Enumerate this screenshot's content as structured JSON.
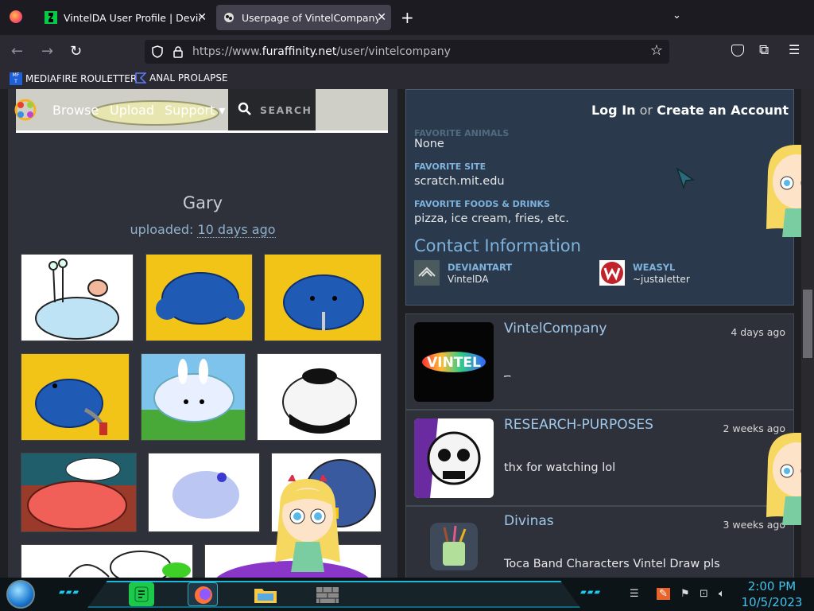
{
  "browser": {
    "tabs": [
      {
        "title": "VintelDA User Profile | DeviantA",
        "active": false
      },
      {
        "title": "Userpage of VintelCompany -- ",
        "active": true
      }
    ],
    "url_prefix": "https://www.",
    "url_domain": "furaffinity.net",
    "url_path": "/user/vintelcompany",
    "bookmarks": [
      {
        "label": "MEDIAFIRE ROULETTER",
        "icon": "mediafire-icon"
      },
      {
        "label": "ANAL PROLAPSE",
        "icon": "bookmark-icon"
      }
    ]
  },
  "site": {
    "nav": {
      "browse": "Browse",
      "upload": "Upload",
      "support": "Support ▾",
      "search": "SEARCH"
    },
    "auth": {
      "login": "Log In",
      "or": "or",
      "create": "Create an Account"
    }
  },
  "gallery": {
    "title": "Gary",
    "uploaded_label": "uploaded:",
    "uploaded_when": "10 days ago"
  },
  "profile": {
    "hidden_label": "FAVORITE ANIMALS",
    "favorite_animals": "None",
    "favorite_site_label": "FAVORITE SITE",
    "favorite_site": "scratch.mit.edu",
    "favorite_foods_label": "FAVORITE FOODS & DRINKS",
    "favorite_foods": "pizza, ice cream, fries, etc.",
    "contact_heading": "Contact Information",
    "contacts": [
      {
        "service": "DEVIANTART",
        "user": "VintelDA"
      },
      {
        "service": "WEASYL",
        "user": "~justaletter"
      }
    ]
  },
  "comments": [
    {
      "user": "VintelCompany",
      "date": "4 days ago",
      "text": "؁"
    },
    {
      "user": "RESEARCH-PURPOSES",
      "date": "2 weeks ago",
      "text": "thx for watching lol"
    },
    {
      "user": "Divinas",
      "date": "3 weeks ago",
      "text": "Toca Band Characters Vintel Draw pls"
    }
  ],
  "avatar_vintel_text": "VINTEL",
  "taskbar": {
    "time": "2:00 PM",
    "date": "10/5/2023"
  },
  "colors": {
    "accent": "#7eb2dc",
    "link": "#9fc8ea",
    "clock": "#42c4ee"
  }
}
